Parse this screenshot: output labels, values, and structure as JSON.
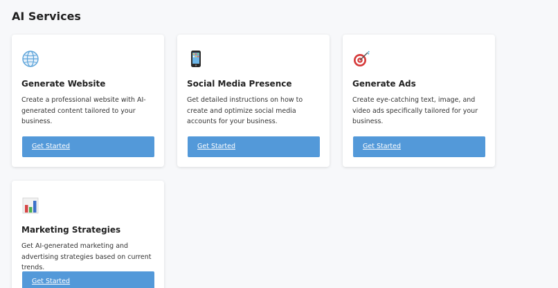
{
  "header": {
    "title": "AI Services"
  },
  "cards": [
    {
      "icon": "globe-icon",
      "title": "Generate Website",
      "description": "Create a professional website with AI-generated content tailored to your business.",
      "cta_label": "Get Started"
    },
    {
      "icon": "mobile-phone-icon",
      "title": "Social Media Presence",
      "description": "Get detailed instructions on how to create and optimize social media accounts for your business.",
      "cta_label": "Get Started"
    },
    {
      "icon": "target-dart-icon",
      "title": "Generate Ads",
      "description": "Create eye-catching text, image, and video ads specifically tailored for your business.",
      "cta_label": "Get Started"
    },
    {
      "icon": "bar-chart-icon",
      "title": "Marketing Strategies",
      "description": "Get AI-generated marketing and advertising strategies based on current trends.",
      "cta_label": "Get Started"
    }
  ],
  "colors": {
    "background": "#f7f8fa",
    "card": "#ffffff",
    "button": "#5399d9",
    "button_text": "#ffffff"
  }
}
